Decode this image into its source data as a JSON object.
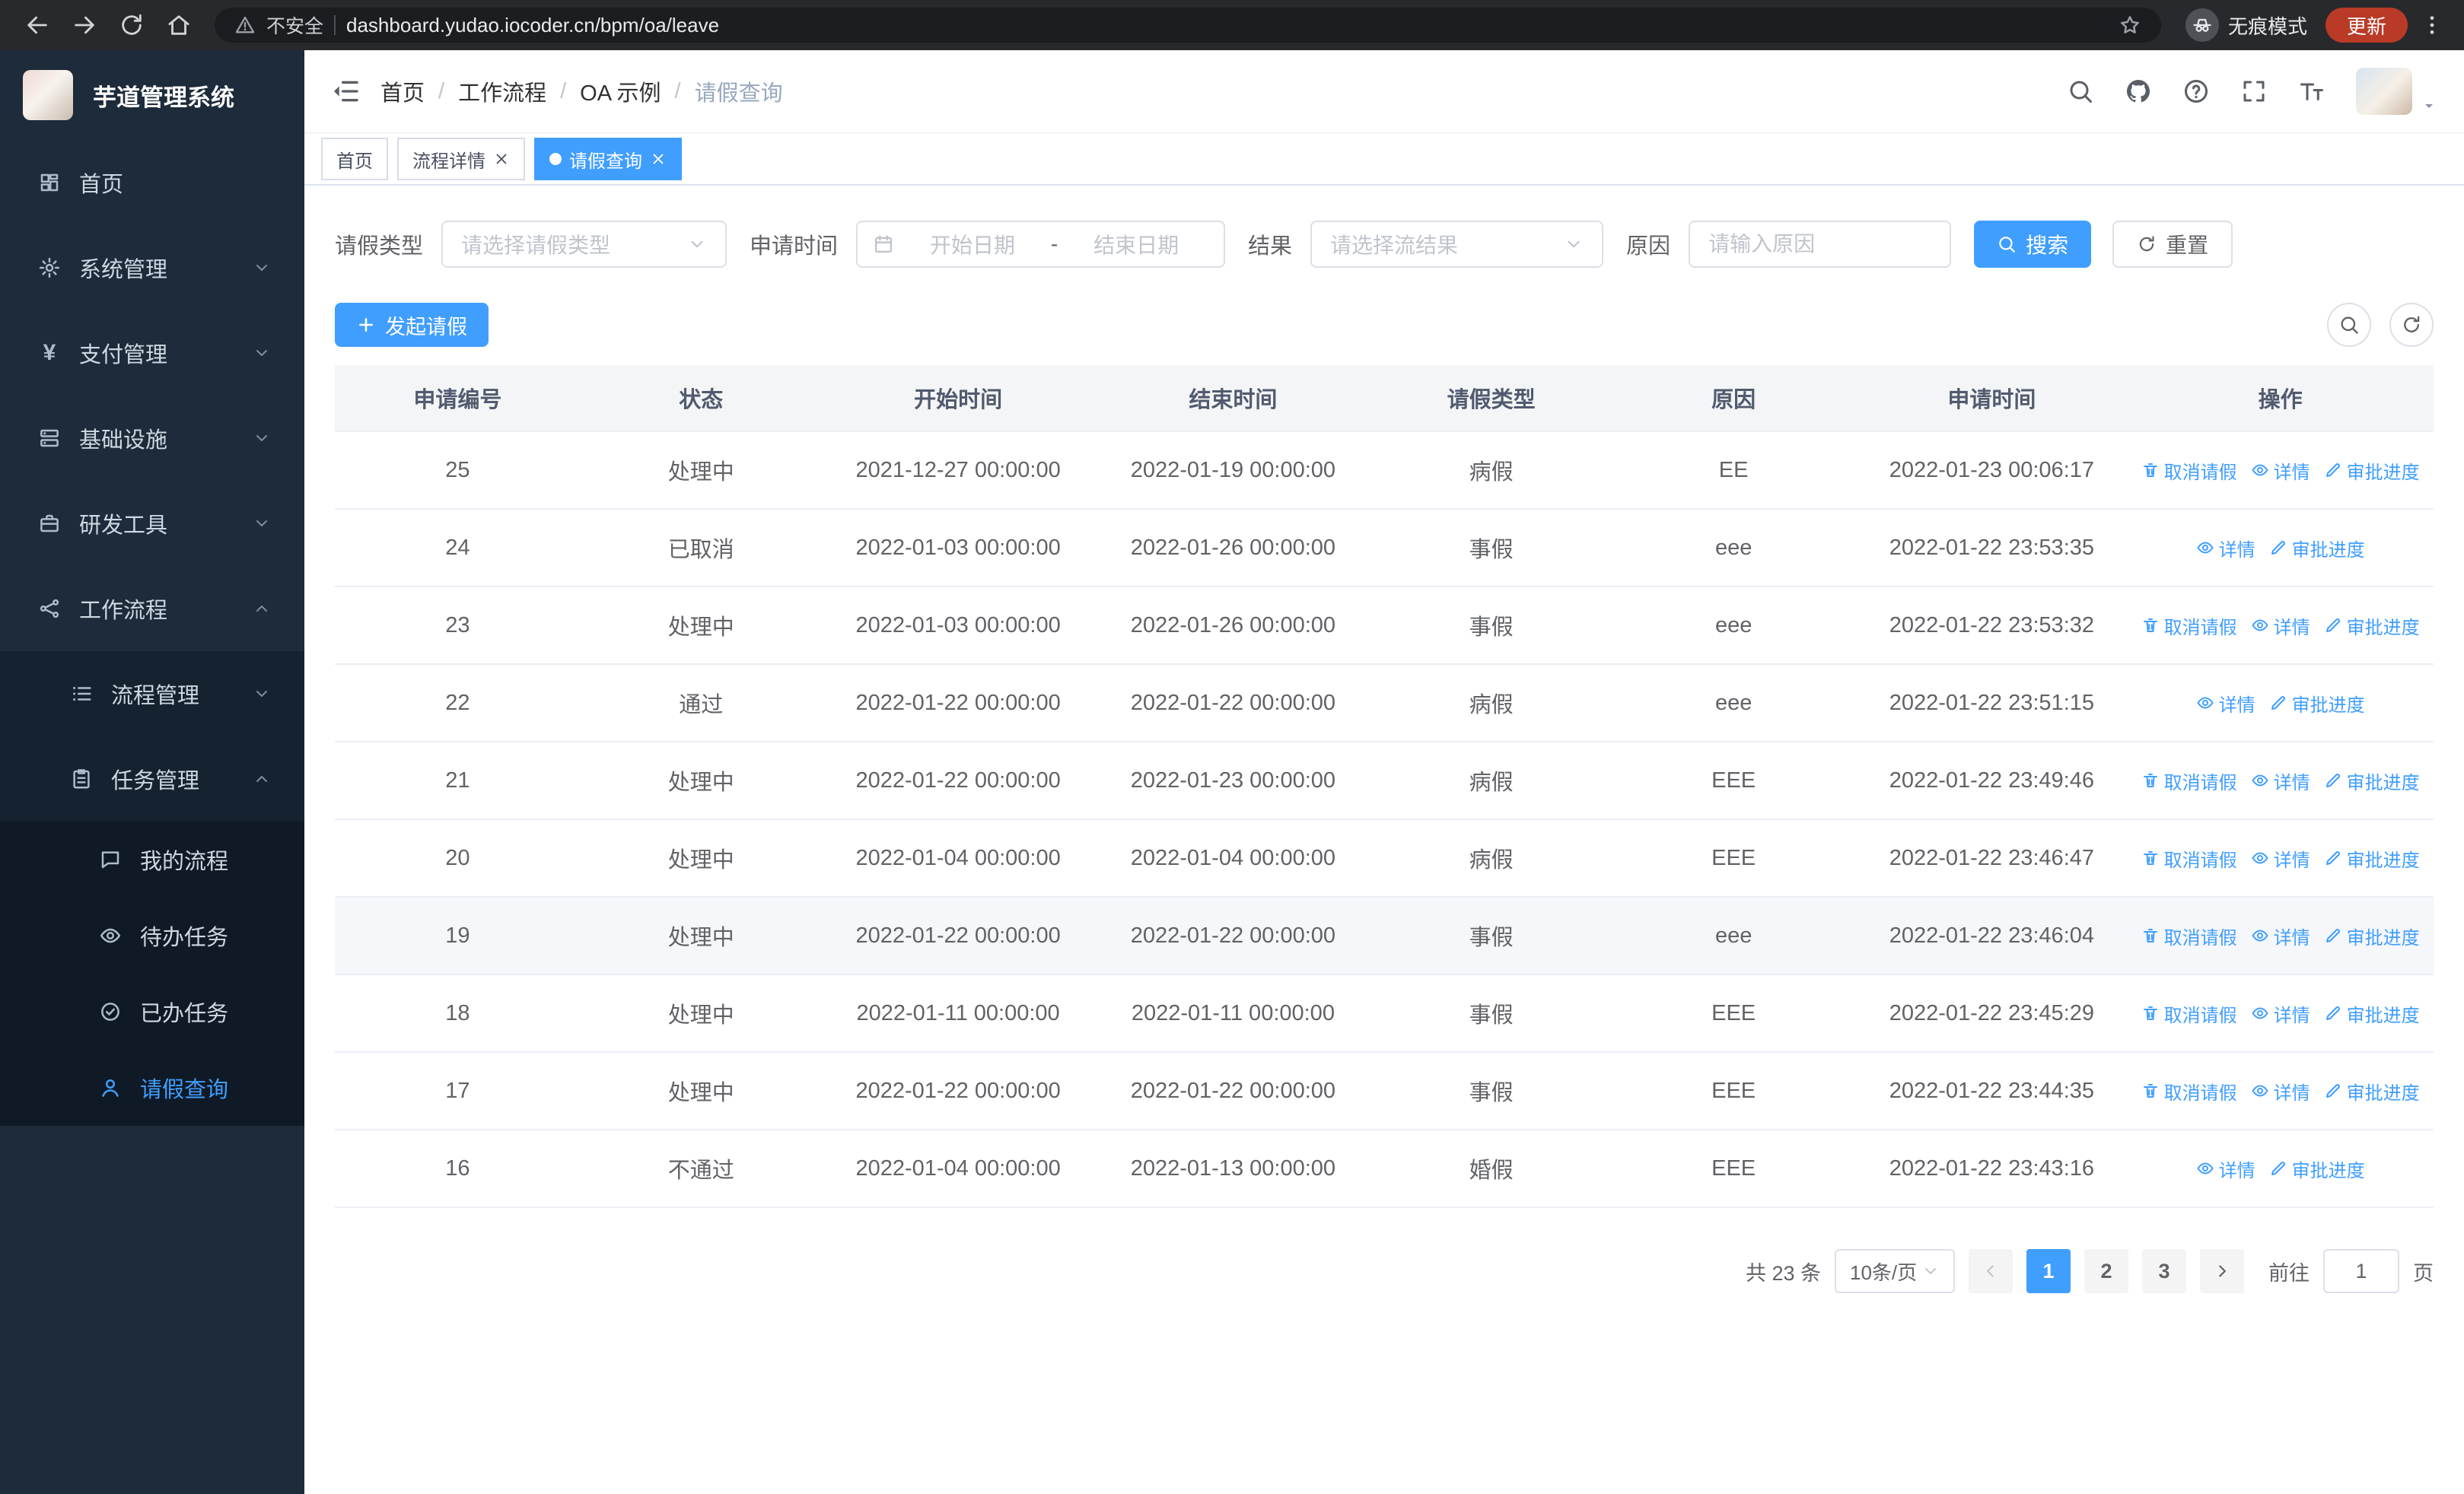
{
  "colors": {
    "primary": "#409eff",
    "sidebar_bg": "#1d2b3a",
    "chrome_bg": "#28292d"
  },
  "browser": {
    "security_label": "不安全",
    "url": "dashboard.yudao.iocoder.cn/bpm/oa/leave",
    "incognito_label": "无痕模式",
    "update_label": "更新"
  },
  "sidebar": {
    "app_title": "芋道管理系统",
    "items": [
      {
        "label": "首页"
      },
      {
        "label": "系统管理"
      },
      {
        "label": "支付管理"
      },
      {
        "label": "基础设施"
      },
      {
        "label": "研发工具"
      },
      {
        "label": "工作流程"
      },
      {
        "label": "流程管理"
      },
      {
        "label": "任务管理"
      },
      {
        "label": "我的流程"
      },
      {
        "label": "待办任务"
      },
      {
        "label": "已办任务"
      },
      {
        "label": "请假查询"
      }
    ]
  },
  "header": {
    "breadcrumb": [
      "首页",
      "工作流程",
      "OA 示例",
      "请假查询"
    ],
    "separator": "/"
  },
  "tabs": [
    {
      "label": "首页"
    },
    {
      "label": "流程详情"
    },
    {
      "label": "请假查询"
    }
  ],
  "filters": {
    "leave_type_label": "请假类型",
    "leave_type_placeholder": "请选择请假类型",
    "apply_time_label": "申请时间",
    "start_date_placeholder": "开始日期",
    "range_separator": "-",
    "end_date_placeholder": "结束日期",
    "result_label": "结果",
    "result_placeholder": "请选择流结果",
    "reason_label": "原因",
    "reason_placeholder": "请输入原因",
    "search_label": "搜索",
    "reset_label": "重置"
  },
  "toolbar": {
    "create_label": "发起请假"
  },
  "table": {
    "columns": [
      "申请编号",
      "状态",
      "开始时间",
      "结束时间",
      "请假类型",
      "原因",
      "申请时间",
      "操作"
    ],
    "action_defs": {
      "cancel": {
        "label": "取消请假",
        "icon": "delete-icon",
        "name": "cancel-leave-link"
      },
      "detail": {
        "label": "详情",
        "icon": "view-icon",
        "name": "detail-link"
      },
      "progress": {
        "label": "审批进度",
        "icon": "edit-icon",
        "name": "audit-progress-link"
      }
    },
    "rows": [
      {
        "id": "25",
        "status": "处理中",
        "start_time": "2021-12-27 00:00:00",
        "end_time": "2022-01-19 00:00:00",
        "leave_type": "病假",
        "reason": "EE",
        "apply_time": "2022-01-23 00:06:17",
        "actions": [
          "cancel",
          "detail",
          "progress"
        ]
      },
      {
        "id": "24",
        "status": "已取消",
        "start_time": "2022-01-03 00:00:00",
        "end_time": "2022-01-26 00:00:00",
        "leave_type": "事假",
        "reason": "eee",
        "apply_time": "2022-01-22 23:53:35",
        "actions": [
          "detail",
          "progress"
        ]
      },
      {
        "id": "23",
        "status": "处理中",
        "start_time": "2022-01-03 00:00:00",
        "end_time": "2022-01-26 00:00:00",
        "leave_type": "事假",
        "reason": "eee",
        "apply_time": "2022-01-22 23:53:32",
        "actions": [
          "cancel",
          "detail",
          "progress"
        ]
      },
      {
        "id": "22",
        "status": "通过",
        "start_time": "2022-01-22 00:00:00",
        "end_time": "2022-01-22 00:00:00",
        "leave_type": "病假",
        "reason": "eee",
        "apply_time": "2022-01-22 23:51:15",
        "actions": [
          "detail",
          "progress"
        ]
      },
      {
        "id": "21",
        "status": "处理中",
        "start_time": "2022-01-22 00:00:00",
        "end_time": "2022-01-23 00:00:00",
        "leave_type": "病假",
        "reason": "EEE",
        "apply_time": "2022-01-22 23:49:46",
        "actions": [
          "cancel",
          "detail",
          "progress"
        ]
      },
      {
        "id": "20",
        "status": "处理中",
        "start_time": "2022-01-04 00:00:00",
        "end_time": "2022-01-04 00:00:00",
        "leave_type": "病假",
        "reason": "EEE",
        "apply_time": "2022-01-22 23:46:47",
        "actions": [
          "cancel",
          "detail",
          "progress"
        ]
      },
      {
        "id": "19",
        "status": "处理中",
        "start_time": "2022-01-22 00:00:00",
        "end_time": "2022-01-22 00:00:00",
        "leave_type": "事假",
        "reason": "eee",
        "apply_time": "2022-01-22 23:46:04",
        "highlighted": true,
        "actions": [
          "cancel",
          "detail",
          "progress"
        ]
      },
      {
        "id": "18",
        "status": "处理中",
        "start_time": "2022-01-11 00:00:00",
        "end_time": "2022-01-11 00:00:00",
        "leave_type": "事假",
        "reason": "EEE",
        "apply_time": "2022-01-22 23:45:29",
        "actions": [
          "cancel",
          "detail",
          "progress"
        ]
      },
      {
        "id": "17",
        "status": "处理中",
        "start_time": "2022-01-22 00:00:00",
        "end_time": "2022-01-22 00:00:00",
        "leave_type": "事假",
        "reason": "EEE",
        "apply_time": "2022-01-22 23:44:35",
        "actions": [
          "cancel",
          "detail",
          "progress"
        ]
      },
      {
        "id": "16",
        "status": "不通过",
        "start_time": "2022-01-04 00:00:00",
        "end_time": "2022-01-13 00:00:00",
        "leave_type": "婚假",
        "reason": "EEE",
        "apply_time": "2022-01-22 23:43:16",
        "actions": [
          "detail",
          "progress"
        ]
      }
    ]
  },
  "pagination": {
    "total_label": "共 23 条",
    "page_size": "10条/页",
    "pages": [
      "1",
      "2",
      "3"
    ],
    "active_page": "1",
    "goto_label": "前往",
    "goto_value": "1",
    "page_suffix": "页"
  }
}
